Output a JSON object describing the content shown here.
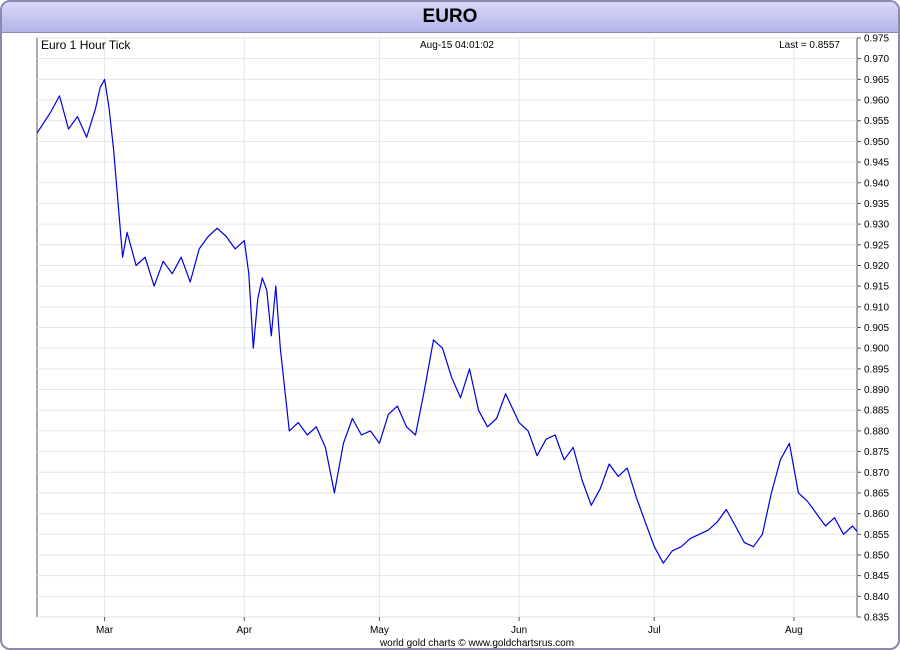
{
  "window": {
    "title": "EURO"
  },
  "chart_data": {
    "type": "line",
    "title": "EURO",
    "subtitle": "Euro 1 Hour Tick",
    "timestamp": "Aug-15  04:01:02",
    "last_label": "Last = 0.8557",
    "footer": "world gold charts © www.goldchartsrus.com",
    "line_color": "#0000dd",
    "grid": true,
    "ylim": [
      0.835,
      0.975
    ],
    "y_ticks": [
      "0.975",
      "0.970",
      "0.965",
      "0.960",
      "0.955",
      "0.950",
      "0.945",
      "0.940",
      "0.935",
      "0.930",
      "0.925",
      "0.920",
      "0.915",
      "0.910",
      "0.905",
      "0.900",
      "0.895",
      "0.890",
      "0.885",
      "0.880",
      "0.875",
      "0.870",
      "0.865",
      "0.860",
      "0.855",
      "0.850",
      "0.845",
      "0.840",
      "0.835"
    ],
    "x_range": [
      "2000-02-15",
      "2000-08-15"
    ],
    "month_ticks": [
      {
        "label": "Mar",
        "date": "2000-03-01"
      },
      {
        "label": "Apr",
        "date": "2000-04-01"
      },
      {
        "label": "May",
        "date": "2000-05-01"
      },
      {
        "label": "Jun",
        "date": "2000-06-01"
      },
      {
        "label": "Jul",
        "date": "2000-07-01"
      },
      {
        "label": "Aug",
        "date": "2000-08-01"
      }
    ],
    "series": [
      {
        "x": [
          "2000-02-15",
          "2000-02-18",
          "2000-02-20",
          "2000-02-22",
          "2000-02-24",
          "2000-02-26",
          "2000-02-28",
          "2000-02-29",
          "2000-03-01",
          "2000-03-02",
          "2000-03-03",
          "2000-03-04",
          "2000-03-05",
          "2000-03-06",
          "2000-03-08",
          "2000-03-10",
          "2000-03-12",
          "2000-03-14",
          "2000-03-16",
          "2000-03-18",
          "2000-03-20",
          "2000-03-22",
          "2000-03-24",
          "2000-03-26",
          "2000-03-28",
          "2000-03-30",
          "2000-04-01",
          "2000-04-02",
          "2000-04-03",
          "2000-04-04",
          "2000-04-05",
          "2000-04-06",
          "2000-04-07",
          "2000-04-08",
          "2000-04-09",
          "2000-04-11",
          "2000-04-13",
          "2000-04-15",
          "2000-04-17",
          "2000-04-19",
          "2000-04-21",
          "2000-04-23",
          "2000-04-25",
          "2000-04-27",
          "2000-04-29",
          "2000-05-01",
          "2000-05-03",
          "2000-05-05",
          "2000-05-07",
          "2000-05-09",
          "2000-05-11",
          "2000-05-13",
          "2000-05-15",
          "2000-05-17",
          "2000-05-19",
          "2000-05-21",
          "2000-05-23",
          "2000-05-25",
          "2000-05-27",
          "2000-05-29",
          "2000-06-01",
          "2000-06-03",
          "2000-06-05",
          "2000-06-07",
          "2000-06-09",
          "2000-06-11",
          "2000-06-13",
          "2000-06-15",
          "2000-06-17",
          "2000-06-19",
          "2000-06-21",
          "2000-06-23",
          "2000-06-25",
          "2000-06-27",
          "2000-06-29",
          "2000-07-01",
          "2000-07-03",
          "2000-07-05",
          "2000-07-07",
          "2000-07-09",
          "2000-07-11",
          "2000-07-13",
          "2000-07-15",
          "2000-07-17",
          "2000-07-19",
          "2000-07-21",
          "2000-07-23",
          "2000-07-25",
          "2000-07-27",
          "2000-07-29",
          "2000-07-31",
          "2000-08-02",
          "2000-08-04",
          "2000-08-06",
          "2000-08-08",
          "2000-08-10",
          "2000-08-12",
          "2000-08-14",
          "2000-08-15"
        ],
        "y": [
          0.952,
          0.957,
          0.961,
          0.953,
          0.956,
          0.951,
          0.958,
          0.963,
          0.965,
          0.958,
          0.948,
          0.935,
          0.922,
          0.928,
          0.92,
          0.922,
          0.915,
          0.921,
          0.918,
          0.922,
          0.916,
          0.924,
          0.927,
          0.929,
          0.927,
          0.924,
          0.926,
          0.918,
          0.9,
          0.912,
          0.917,
          0.914,
          0.903,
          0.915,
          0.9,
          0.88,
          0.882,
          0.879,
          0.881,
          0.876,
          0.865,
          0.877,
          0.883,
          0.879,
          0.88,
          0.877,
          0.884,
          0.886,
          0.881,
          0.879,
          0.89,
          0.902,
          0.9,
          0.893,
          0.888,
          0.895,
          0.885,
          0.881,
          0.883,
          0.889,
          0.882,
          0.88,
          0.874,
          0.878,
          0.879,
          0.873,
          0.876,
          0.868,
          0.862,
          0.866,
          0.872,
          0.869,
          0.871,
          0.864,
          0.858,
          0.852,
          0.848,
          0.851,
          0.852,
          0.854,
          0.855,
          0.856,
          0.858,
          0.861,
          0.857,
          0.853,
          0.852,
          0.855,
          0.865,
          0.873,
          0.877,
          0.865,
          0.863,
          0.86,
          0.857,
          0.859,
          0.855,
          0.857,
          0.8557
        ]
      }
    ]
  }
}
